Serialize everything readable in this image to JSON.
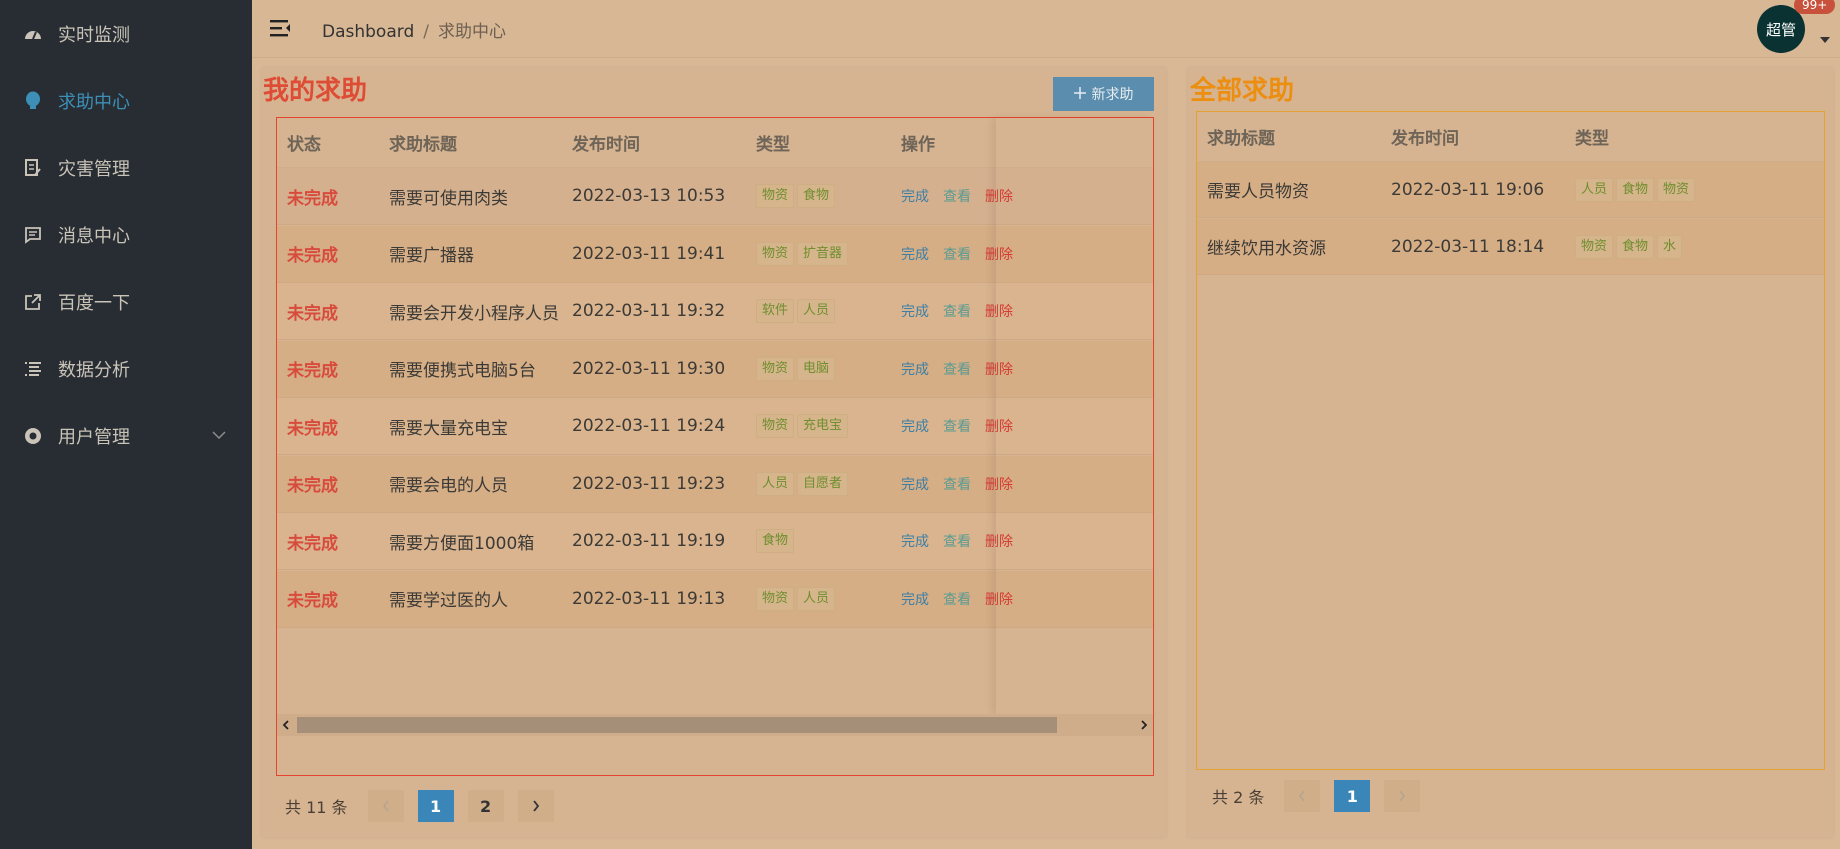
{
  "sidebar": {
    "items": [
      {
        "label": "实时监测",
        "icon": "dashboard-icon"
      },
      {
        "label": "求助中心",
        "icon": "help-bulb-icon"
      },
      {
        "label": "灾害管理",
        "icon": "document-edit-icon"
      },
      {
        "label": "消息中心",
        "icon": "message-icon"
      },
      {
        "label": "百度一下",
        "icon": "external-link-icon"
      },
      {
        "label": "数据分析",
        "icon": "list-icon"
      },
      {
        "label": "用户管理",
        "icon": "user-circle-icon"
      }
    ],
    "active_index": 1
  },
  "header": {
    "breadcrumb_root": "Dashboard",
    "breadcrumb_sep": "/",
    "breadcrumb_current": "求助中心",
    "avatar_text": "超管",
    "badge": "99+"
  },
  "my_help": {
    "title": "我的求助",
    "new_button": "新求助",
    "columns": [
      "状态",
      "求助标题",
      "发布时间",
      "类型",
      "操作"
    ],
    "actions": {
      "done": "完成",
      "view": "查看",
      "delete": "删除"
    },
    "rows": [
      {
        "status": "未完成",
        "title": "需要可使用肉类",
        "time": "2022-03-13 10:53",
        "tags": [
          "物资",
          "食物"
        ]
      },
      {
        "status": "未完成",
        "title": "需要广播器",
        "time": "2022-03-11 19:41",
        "tags": [
          "物资",
          "扩音器"
        ]
      },
      {
        "status": "未完成",
        "title": "需要会开发小程序人员",
        "time": "2022-03-11 19:32",
        "tags": [
          "软件",
          "人员"
        ]
      },
      {
        "status": "未完成",
        "title": "需要便携式电脑5台",
        "time": "2022-03-11 19:30",
        "tags": [
          "物资",
          "电脑"
        ]
      },
      {
        "status": "未完成",
        "title": "需要大量充电宝",
        "time": "2022-03-11 19:24",
        "tags": [
          "物资",
          "充电宝"
        ]
      },
      {
        "status": "未完成",
        "title": "需要会电的人员",
        "time": "2022-03-11 19:23",
        "tags": [
          "人员",
          "自愿者"
        ]
      },
      {
        "status": "未完成",
        "title": "需要方便面1000箱",
        "time": "2022-03-11 19:19",
        "tags": [
          "食物"
        ]
      },
      {
        "status": "未完成",
        "title": "需要学过医的人",
        "time": "2022-03-11 19:13",
        "tags": [
          "物资",
          "人员"
        ]
      }
    ],
    "pager": {
      "total": "共 11 条",
      "pages": [
        "1",
        "2"
      ],
      "current": "1"
    }
  },
  "all_help": {
    "title": "全部求助",
    "columns": [
      "求助标题",
      "发布时间",
      "类型"
    ],
    "rows": [
      {
        "title": "需要人员物资",
        "time": "2022-03-11 19:06",
        "tags": [
          "人员",
          "食物",
          "物资"
        ]
      },
      {
        "title": "继续饮用水资源",
        "time": "2022-03-11 18:14",
        "tags": [
          "物资",
          "食物",
          "水"
        ]
      }
    ],
    "pager": {
      "total": "共 2 条",
      "pages": [
        "1"
      ],
      "current": "1"
    }
  },
  "colors": {
    "sidebar_bg": "#272d33",
    "active_menu": "#3d8fb7",
    "my_title": "#de4c36",
    "all_title": "#ec8e10",
    "status_red": "#d84b3c",
    "pager_active": "#3a86b8"
  }
}
